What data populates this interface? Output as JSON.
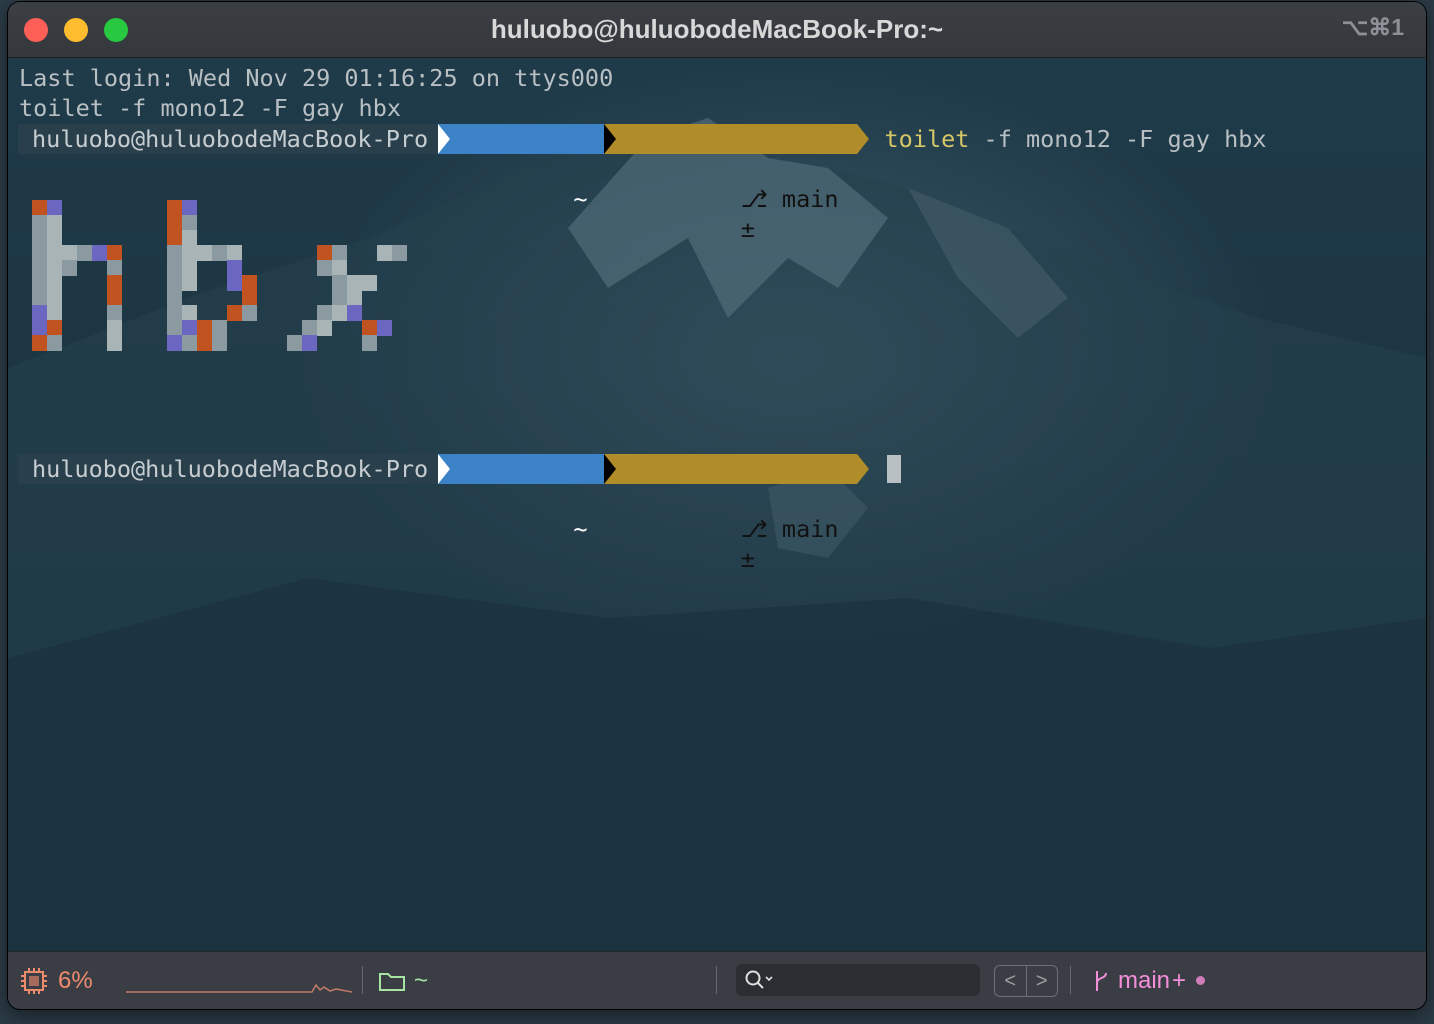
{
  "window": {
    "title": "huluobo@huluobodeMacBook-Pro:~",
    "shortcut": "⌥⌘1"
  },
  "terminal": {
    "last_login": "Last login: Wed Nov 29 01:16:25 on ttys000",
    "echoed_command": "toilet -f mono12 -F gay hbx",
    "prompts": [
      {
        "user_host": "huluobo@huluobodeMacBook-Pro",
        "dir": "~",
        "git_branch": "main",
        "git_status": "±",
        "command_name": "toilet",
        "command_args": " -f mono12 -F gay hbx"
      },
      {
        "user_host": "huluobo@huluobodeMacBook-Pro",
        "dir": "~",
        "git_branch": "main",
        "git_status": "±",
        "command_name": "",
        "command_args": ""
      }
    ],
    "banner_text": "hbx",
    "banner_colors": {
      "gray": "#8a9aa0",
      "light": "#a8b4b6",
      "orange": "#c0531f",
      "purple": "#6b67c0"
    }
  },
  "statusbar": {
    "cpu_icon": "cpu-icon",
    "cpu_percent": "6%",
    "folder_icon": "folder-icon",
    "folder_path": "~",
    "search_icon": "search-icon",
    "search_placeholder": "",
    "nav_back": "<",
    "nav_forward": ">",
    "branch_icon": "git-branch-icon",
    "branch_name": "main",
    "branch_status": "+",
    "colors": {
      "cpu": "#ee8b6d",
      "folder": "#a7e3a5",
      "branch": "#f58ed9"
    }
  }
}
